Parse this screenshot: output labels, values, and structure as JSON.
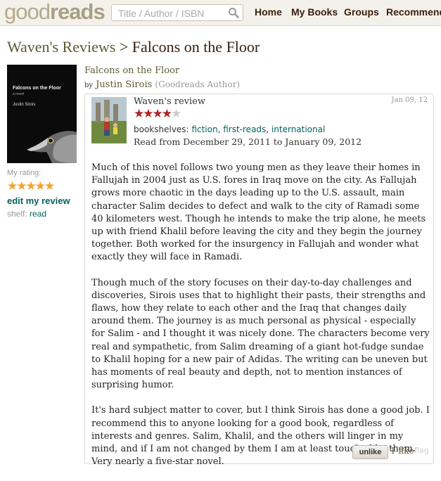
{
  "header": {
    "logo_light": "good",
    "logo_bold": "reads",
    "search_placeholder": "Title / Author / ISBN",
    "nav": [
      "Home",
      "My Books",
      "Groups",
      "Recommend"
    ]
  },
  "page": {
    "crumb": "Waven's Reviews",
    "separator": ">",
    "title": "Falcons on the Floor"
  },
  "book": {
    "title": "Falcons on the Floor",
    "by": "by",
    "author": "Justin Sirois",
    "author_role": "(Goodreads Author)",
    "cover": {
      "title": "Falcons on the Floor",
      "subtitle": "a novel",
      "author": "Justin Sirois"
    }
  },
  "sidebar": {
    "my_rating_label": "My rating:",
    "my_rating_stars": "★★★★★",
    "edit_review": "edit my review",
    "shelf_label": "shelf:",
    "shelf_value": "read"
  },
  "review": {
    "title": "Waven's review",
    "rating": 4,
    "rating_max": 5,
    "stars_on": "★★★★",
    "stars_off": "★",
    "date": "Jan 09, 12",
    "bookshelves_label": "bookshelves:",
    "shelves": [
      "fiction",
      "first-reads",
      "international"
    ],
    "read_range": "Read from December 29, 2011 to January 09, 2012",
    "paragraphs": [
      "Much of this novel follows two young men as they leave their homes in Fallujah in 2004 just as U.S. fores in Iraq move on the city. As Fallujah grows more chaotic in the days leading up to the U.S. assault, main character Salim decides to defect and walk to the city of Ramadi some 40 kilometers west. Though he intends to make the trip alone, he meets up with friend Khalil before leaving the city and they begin the journey together. Both worked for the insurgency in Fallujah and wonder what exactly they will face in Ramadi.",
      "Though much of the story focuses on their day-to-day challenges and discoveries, Sirois uses that to highlight their pasts, their strengths and flaws, how they relate to each other and the Iraq that changes daily around them. The journey is as much personal as physical - especially for Salim - and I thought it was nicely done. The characters become very real and sympathetic, from Salim dreaming of a giant hot-fudge sundae to Khalil hoping for a new pair of Adidas. The writing can be uneven but has moments of real beauty and depth, not to mention instances of surprising humor.",
      "It's hard subject matter to cover, but I think Sirois has done a good job. I recommend this to anyone looking for a good book, regardless of interests and genres. Salim, Khalil, and the others will linger in my mind, and if I am not changed by them I am at least touched by them. Very nearly a five-star novel."
    ],
    "unlike_label": "unlike",
    "likes": "1 like",
    "flag": "flag"
  },
  "colors": {
    "brand_bar": "#f4f1ea",
    "link_green": "#00635d",
    "title_olive": "#5f5b33",
    "star_orange": "#f3a32b",
    "star_red": "#b22222"
  }
}
